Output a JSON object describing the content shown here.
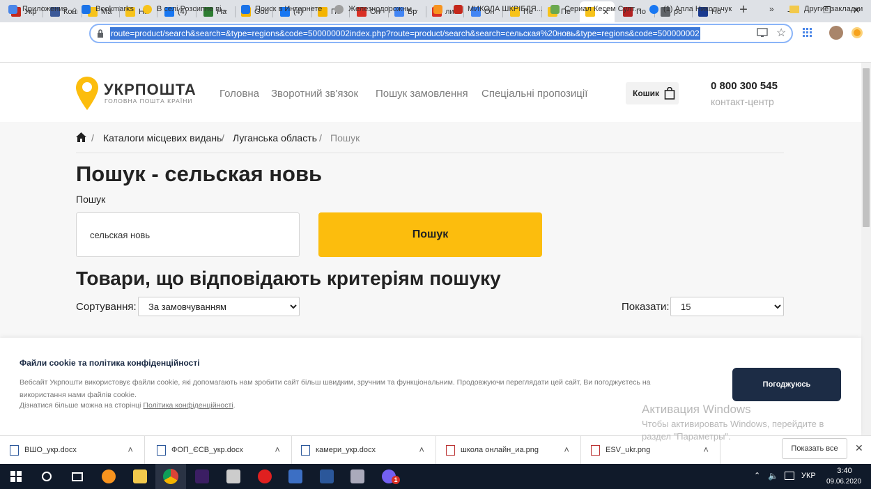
{
  "browser": {
    "tabs": [
      {
        "label": "Укр",
        "color": "#c4281c"
      },
      {
        "label": "Кон",
        "color": "#3b5998"
      },
      {
        "label": "Ма",
        "color": "#f7c31a"
      },
      {
        "label": "На",
        "color": "#f7c31a"
      },
      {
        "label": "(4)",
        "color": "#1877f2"
      },
      {
        "label": "На",
        "color": "#2e7d32"
      },
      {
        "label": "Goo",
        "color": "#f4b400"
      },
      {
        "label": "(4)",
        "color": "#1877f2"
      },
      {
        "label": "Пе",
        "color": "#f4b400"
      },
      {
        "label": "Он",
        "color": "#d93025"
      },
      {
        "label": "Бр",
        "color": "#4285f4"
      },
      {
        "label": "лис",
        "color": "#d93025"
      },
      {
        "label": "Он",
        "color": "#4285f4"
      },
      {
        "label": "Пе",
        "color": "#f7c31a"
      },
      {
        "label": "Пе",
        "color": "#f7c31a"
      },
      {
        "label": "",
        "color": "#f7c31a",
        "active": true
      },
      {
        "label": "По",
        "color": "#b22222"
      },
      {
        "label": "ро",
        "color": "#5f6368"
      },
      {
        "label": "Но",
        "color": "#1a3a8f"
      }
    ],
    "url": "route=product/search&search=&type=regions&code=500000002index.php?route=product/search&search=сельская%20новь&type=regions&code=500000002",
    "bookmarks": [
      {
        "label": "Приложения",
        "icon": "apps-icon"
      },
      {
        "label": "Bookmarks",
        "icon": "star-icon"
      },
      {
        "label": "В селі Розсипне пі...",
        "icon": "circle-icon"
      },
      {
        "label": "Поиск в Интернете",
        "icon": "search-icon"
      },
      {
        "label": "Железнодорожны...",
        "icon": "train-icon"
      },
      {
        "label": "",
        "icon": "ok-icon"
      },
      {
        "label": "МИКОЛА ШКРІБЛЯ...",
        "icon": "flag-icon"
      },
      {
        "label": "Сериал Кесем Султ...",
        "icon": "tv-icon"
      },
      {
        "label": "(1) Алла Никольчук",
        "icon": "facebook-icon"
      }
    ],
    "bookmarks_more": "»",
    "other_bookmarks": "Другие закладки"
  },
  "site": {
    "logo_title": "УКРПОШТА",
    "logo_subtitle": "ГОЛОВНА ПОШТА КРАЇНИ",
    "nav": [
      "Головна",
      "Зворотний зв'язок",
      "Пошук замовлення",
      "Спеціальні пропозиції"
    ],
    "cart_label": "Кошик",
    "phone": "0 800 300 545",
    "phone_caption": "контакт-центр",
    "accent": "#fcbd0d",
    "breadcrumb": [
      "Каталоги місцевих видань",
      "Луганська область",
      "Пошук"
    ],
    "page_title": "Пошук - сельская новь",
    "search_label": "Пошук",
    "search_value": "сельская новь",
    "search_button": "Пошук",
    "results_title": "Товари, що відповідають критеріям пошуку",
    "sort_label": "Сортування:",
    "sort_value": "За замовчуванням",
    "show_label": "Показати:",
    "show_value": "15"
  },
  "cookie": {
    "title": "Файли cookie та політика конфіденційності",
    "text": "Вебсайт Укрпошти використовує файли cookie, які допомагають нам зробити сайт більш швидким, зручним та функціональним. Продовжуючи переглядати цей сайт, Ви погоджуєтесь на використання нами файлів cookie.",
    "more_prefix": "Дізнатися більше можна на сторінці ",
    "more_link": "Політика конфіденційності",
    "more_suffix": ".",
    "accept_button": "Погоджуюсь"
  },
  "watermark": {
    "title": "Активация Windows",
    "line1": "Чтобы активировать Windows, перейдите в",
    "line2": "раздел \"Параметры\"."
  },
  "downloads": {
    "items": [
      "ВШО_укр.docx",
      "ФОП_ЄСВ_укр.docx",
      "камери_укр.docx",
      "школа онлайн_иа.png",
      "ESV_ukr.png"
    ],
    "show_all": "Показать все"
  },
  "taskbar": {
    "lang": "УКР",
    "time": "3:40",
    "date": "09.06.2020",
    "badge": "1"
  }
}
